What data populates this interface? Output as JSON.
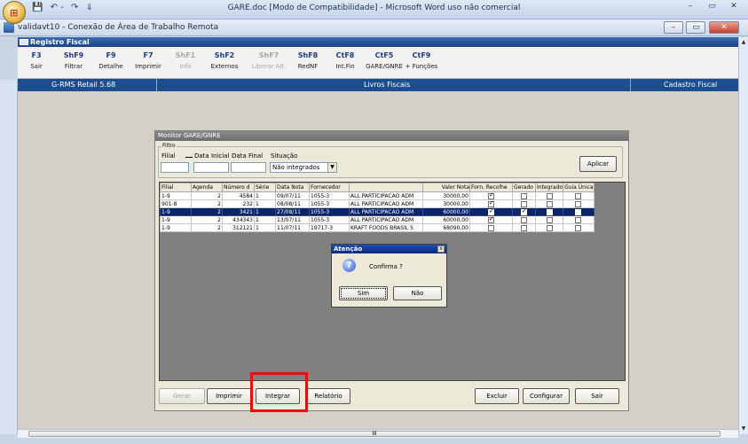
{
  "word": {
    "title": "GARE.doc [Modo de Compatibilidade] - Microsoft Word uso não comercial",
    "qat": [
      "💾",
      "↶ -",
      "↷",
      "⇓"
    ],
    "controls": [
      "–",
      "▭",
      "✕"
    ]
  },
  "rdp": {
    "title": "validavt10 - Conexão de Área de Trabalho Remota",
    "controls": [
      "–",
      "▭",
      "✕"
    ]
  },
  "module": {
    "title": "Registro Fiscal"
  },
  "fkeys": [
    {
      "key": "F3",
      "label": "Sair"
    },
    {
      "key": "ShF9",
      "label": "Filtrar"
    },
    {
      "key": "F9",
      "label": "Detalhe"
    },
    {
      "key": "F7",
      "label": "Imprimir"
    },
    {
      "key": "ShF1",
      "label": "Info"
    },
    {
      "key": "ShF2",
      "label": "Externos"
    },
    {
      "key": "ShF7",
      "label": "Liberar Alt."
    },
    {
      "key": "ShF8",
      "label": "RedNF"
    },
    {
      "key": "CtF8",
      "label": "Int.Fin"
    },
    {
      "key": "CtF5",
      "label": "GARE/GNRE"
    },
    {
      "key": "CtF9",
      "label": "+ Funções"
    }
  ],
  "band": {
    "left": "G-RMS Retail 5.68",
    "center": "Livros Fiscais",
    "right": "Cadastro Fiscal"
  },
  "monitor": {
    "title": "Monitor GARE/GNRE",
    "filter": {
      "legend": "Filtro",
      "filial_label": "Filial",
      "data_inicial_label": "Data Inicial",
      "data_final_label": "Data Final",
      "situacao_label": "Situação",
      "situacao_value": "Não integrados",
      "apply_label": "Aplicar"
    },
    "columns": [
      "Filial",
      "Agenda",
      "Número d",
      "Série",
      "Data Nota",
      "Fornecedor",
      "",
      "Valor Nota",
      "Forn. Recolhe",
      "Gerado",
      "Integrado",
      "Guia Única"
    ],
    "rows": [
      {
        "filial": "1-9",
        "agenda": "2",
        "numero": "4584",
        "serie": "1",
        "data": "09/07/11",
        "forn_cod": "1055-3",
        "forn_nome": "ALL PARTICIPACAO ADM",
        "valor": "30000,00",
        "recolhe": true,
        "gerado": false,
        "integrado": false,
        "unica": false,
        "selected": false
      },
      {
        "filial": "901-8",
        "agenda": "2",
        "numero": "232",
        "serie": "1",
        "data": "08/08/11",
        "forn_cod": "1055-3",
        "forn_nome": "ALL PARTICIPACAO ADM",
        "valor": "30000,00",
        "recolhe": true,
        "gerado": false,
        "integrado": false,
        "unica": false,
        "selected": false
      },
      {
        "filial": "1-9",
        "agenda": "2",
        "numero": "3421",
        "serie": "1",
        "data": "27/08/11",
        "forn_cod": "1055-3",
        "forn_nome": "ALL PARTICIPACAO ADM",
        "valor": "60000,00",
        "recolhe": true,
        "gerado": true,
        "integrado": false,
        "unica": false,
        "selected": true
      },
      {
        "filial": "1-9",
        "agenda": "2",
        "numero": "434343",
        "serie": "1",
        "data": "13/07/11",
        "forn_cod": "1055-3",
        "forn_nome": "ALL PARTICIPACAO ADM",
        "valor": "60000,00",
        "recolhe": true,
        "gerado": false,
        "integrado": false,
        "unica": false,
        "selected": false
      },
      {
        "filial": "1-9",
        "agenda": "2",
        "numero": "312121",
        "serie": "1",
        "data": "11/07/11",
        "forn_cod": "19717-3",
        "forn_nome": "KRAFT FOODS BRASIL S",
        "valor": "68090,00",
        "recolhe": false,
        "gerado": false,
        "integrado": false,
        "unica": false,
        "selected": false
      }
    ],
    "buttons": {
      "gerar": "Gerar",
      "imprimir": "Imprimir",
      "integrar": "Integrar",
      "relatorio": "Relatório",
      "excluir": "Excluir",
      "configurar": "Configurar",
      "sair": "Sair"
    }
  },
  "confirm": {
    "title": "Atenção",
    "message": "Confirma ?",
    "yes": "Sim",
    "no": "Não",
    "close": "x"
  },
  "scroll": {
    "h_label": "III"
  }
}
